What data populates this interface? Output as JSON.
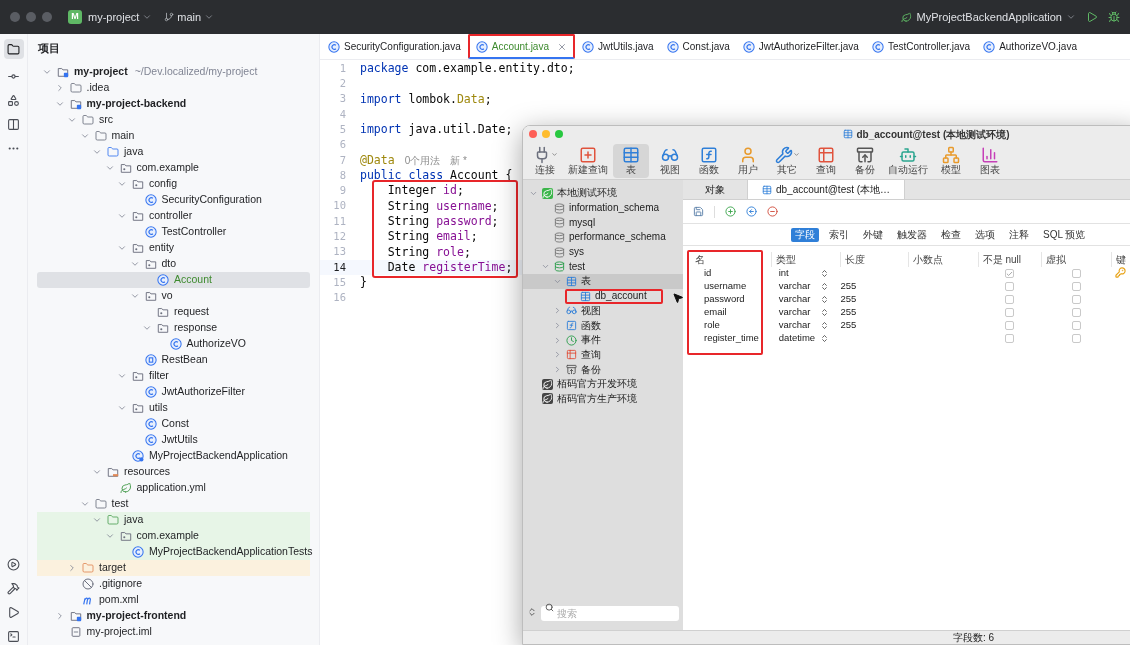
{
  "top_bar": {
    "project_badge": "M",
    "project": "my-project",
    "branch": "main",
    "run_configuration": "MyProjectBackendApplication"
  },
  "project_panel": {
    "title": "项目"
  },
  "project_tree": [
    {
      "name": "my-project",
      "kind": "module",
      "hint": "~/Dev.localized/my-project",
      "expanded": true,
      "selected": false,
      "children": [
        {
          "name": ".idea",
          "kind": "folder",
          "expanded": false,
          "selected": false
        },
        {
          "name": "my-project-backend",
          "kind": "module",
          "expanded": true,
          "selected": false,
          "children": [
            {
              "name": "src",
              "kind": "folder",
              "expanded": true,
              "selected": false,
              "children": [
                {
                  "name": "main",
                  "kind": "folder",
                  "expanded": true,
                  "selected": false,
                  "children": [
                    {
                      "name": "java",
                      "kind": "source-folder",
                      "expanded": true,
                      "selected": false,
                      "children": [
                        {
                          "name": "com.example",
                          "kind": "package",
                          "expanded": true,
                          "selected": false,
                          "children": [
                            {
                              "name": "config",
                              "kind": "package",
                              "expanded": true,
                              "selected": false,
                              "children": [
                                {
                                  "name": "SecurityConfiguration",
                                  "kind": "class",
                                  "selected": false
                                }
                              ]
                            },
                            {
                              "name": "controller",
                              "kind": "package",
                              "expanded": true,
                              "selected": false,
                              "children": [
                                {
                                  "name": "TestController",
                                  "kind": "class",
                                  "selected": false
                                }
                              ]
                            },
                            {
                              "name": "entity",
                              "kind": "package",
                              "expanded": true,
                              "selected": false,
                              "children": [
                                {
                                  "name": "dto",
                                  "kind": "package",
                                  "expanded": true,
                                  "selected": false,
                                  "children": [
                                    {
                                      "name": "Account",
                                      "kind": "class",
                                      "new_file": true,
                                      "selected": true
                                    }
                                  ]
                                },
                                {
                                  "name": "vo",
                                  "kind": "package",
                                  "expanded": true,
                                  "selected": false,
                                  "children": [
                                    {
                                      "name": "request",
                                      "kind": "package",
                                      "selected": false
                                    },
                                    {
                                      "name": "response",
                                      "kind": "package",
                                      "expanded": true,
                                      "selected": false,
                                      "children": [
                                        {
                                          "name": "AuthorizeVO",
                                          "kind": "class",
                                          "selected": false
                                        }
                                      ]
                                    }
                                  ]
                                },
                                {
                                  "name": "RestBean",
                                  "kind": "record",
                                  "selected": false
                                }
                              ]
                            },
                            {
                              "name": "filter",
                              "kind": "package",
                              "expanded": true,
                              "selected": false,
                              "children": [
                                {
                                  "name": "JwtAuthorizeFilter",
                                  "kind": "class",
                                  "selected": false
                                }
                              ]
                            },
                            {
                              "name": "utils",
                              "kind": "package",
                              "expanded": true,
                              "selected": false,
                              "children": [
                                {
                                  "name": "Const",
                                  "kind": "class",
                                  "selected": false
                                },
                                {
                                  "name": "JwtUtils",
                                  "kind": "class",
                                  "selected": false
                                }
                              ]
                            },
                            {
                              "name": "MyProjectBackendApplication",
                              "kind": "app-class",
                              "selected": false
                            }
                          ]
                        }
                      ]
                    },
                    {
                      "name": "resources",
                      "kind": "resources",
                      "expanded": true,
                      "selected": false,
                      "children": [
                        {
                          "name": "application.yml",
                          "kind": "yml",
                          "selected": false
                        }
                      ]
                    }
                  ]
                },
                {
                  "name": "test",
                  "kind": "folder",
                  "expanded": true,
                  "selected": false,
                  "children": [
                    {
                      "name": "java",
                      "kind": "test-folder",
                      "test_source": true,
                      "expanded": true,
                      "selected": false,
                      "children": [
                        {
                          "name": "com.example",
                          "kind": "package",
                          "test_source": true,
                          "expanded": true,
                          "selected": false,
                          "children": [
                            {
                              "name": "MyProjectBackendApplicationTests",
                              "kind": "class",
                              "test_source": true,
                              "selected": false
                            }
                          ]
                        }
                      ]
                    }
                  ]
                }
              ]
            },
            {
              "name": "target",
              "kind": "excluded-folder",
              "excluded": true,
              "expanded": false,
              "selected": false
            },
            {
              "name": ".gitignore",
              "kind": "gitignore",
              "selected": false
            },
            {
              "name": "pom.xml",
              "kind": "maven",
              "selected": false
            }
          ]
        },
        {
          "name": "my-project-frontend",
          "kind": "module",
          "expanded": false,
          "selected": false
        },
        {
          "name": "my-project.iml",
          "kind": "iml",
          "selected": false
        }
      ]
    }
  ],
  "editor_tabs": [
    {
      "label": "SecurityConfiguration.java",
      "selected": false,
      "new_file": false,
      "annotated": false
    },
    {
      "label": "Account.java",
      "selected": true,
      "new_file": true,
      "annotated": true
    },
    {
      "label": "JwtUtils.java",
      "selected": false,
      "new_file": false,
      "annotated": false
    },
    {
      "label": "Const.java",
      "selected": false,
      "new_file": false,
      "annotated": false
    },
    {
      "label": "JwtAuthorizeFilter.java",
      "selected": false,
      "new_file": false,
      "annotated": false
    },
    {
      "label": "TestController.java",
      "selected": false,
      "new_file": false,
      "annotated": false
    },
    {
      "label": "AuthorizeVO.java",
      "selected": false,
      "new_file": false,
      "annotated": false
    }
  ],
  "code_lines": [
    {
      "number": "1",
      "current": false,
      "boxed": false,
      "tokens": [
        {
          "kind": "keyword",
          "text": "package"
        },
        {
          "kind": "plain",
          "text": " com.example.entity.dto;"
        }
      ]
    },
    {
      "number": "2",
      "current": false,
      "boxed": false
    },
    {
      "number": "3",
      "current": false,
      "boxed": false,
      "tokens": [
        {
          "kind": "keyword",
          "text": "import"
        },
        {
          "kind": "plain",
          "text": " lombok."
        },
        {
          "kind": "annotation",
          "text": "Data"
        },
        {
          "kind": "plain",
          "text": ";"
        }
      ]
    },
    {
      "number": "4",
      "current": false,
      "boxed": false
    },
    {
      "number": "5",
      "current": false,
      "boxed": false,
      "tokens": [
        {
          "kind": "keyword",
          "text": "import"
        },
        {
          "kind": "plain",
          "text": " java.util.Date;"
        }
      ]
    },
    {
      "number": "6",
      "current": false,
      "boxed": false
    },
    {
      "number": "7",
      "current": false,
      "boxed": false,
      "tokens": [
        {
          "kind": "annotation",
          "text": "@Data"
        },
        {
          "kind": "hint",
          "text": "0个用法"
        },
        {
          "kind": "hint",
          "text": "新 *"
        }
      ]
    },
    {
      "number": "8",
      "current": false,
      "boxed": false,
      "tokens": [
        {
          "kind": "keyword",
          "text": "public class"
        },
        {
          "kind": "plain",
          "text": " Account {"
        }
      ]
    },
    {
      "number": "9",
      "current": false,
      "boxed": true,
      "tokens": [
        {
          "kind": "plain",
          "text": "    Integer "
        },
        {
          "kind": "field",
          "text": "id"
        },
        {
          "kind": "plain",
          "text": ";"
        }
      ]
    },
    {
      "number": "10",
      "current": false,
      "boxed": true,
      "tokens": [
        {
          "kind": "plain",
          "text": "    String "
        },
        {
          "kind": "field",
          "text": "username"
        },
        {
          "kind": "plain",
          "text": ";"
        }
      ]
    },
    {
      "number": "11",
      "current": false,
      "boxed": true,
      "tokens": [
        {
          "kind": "plain",
          "text": "    String "
        },
        {
          "kind": "field",
          "text": "password"
        },
        {
          "kind": "plain",
          "text": ";"
        }
      ]
    },
    {
      "number": "12",
      "current": false,
      "boxed": true,
      "tokens": [
        {
          "kind": "plain",
          "text": "    String "
        },
        {
          "kind": "field",
          "text": "email"
        },
        {
          "kind": "plain",
          "text": ";"
        }
      ]
    },
    {
      "number": "13",
      "current": false,
      "boxed": true,
      "tokens": [
        {
          "kind": "plain",
          "text": "    String "
        },
        {
          "kind": "field",
          "text": "role"
        },
        {
          "kind": "plain",
          "text": ";"
        }
      ]
    },
    {
      "number": "14",
      "current": true,
      "boxed": true,
      "tokens": [
        {
          "kind": "plain",
          "text": "    Date "
        },
        {
          "kind": "field",
          "text": "registerTime"
        },
        {
          "kind": "plain",
          "text": ";"
        }
      ]
    },
    {
      "number": "15",
      "current": false,
      "boxed": false,
      "tokens": [
        {
          "kind": "plain",
          "text": "}"
        }
      ]
    },
    {
      "number": "16",
      "current": false,
      "boxed": false
    }
  ],
  "db_window": {
    "title": "db_account@test (本地测试环境)",
    "toolbar": [
      {
        "label": "连接",
        "kind": "connect",
        "has_menu": true,
        "selected": false
      },
      {
        "label": "新建查询",
        "kind": "new-query",
        "has_menu": false,
        "selected": false
      },
      {
        "label": "表",
        "kind": "table",
        "has_menu": false,
        "selected": true
      },
      {
        "label": "视图",
        "kind": "view",
        "has_menu": false,
        "selected": false
      },
      {
        "label": "函数",
        "kind": "function",
        "has_menu": false,
        "selected": false
      },
      {
        "label": "用户",
        "kind": "user",
        "has_menu": false,
        "selected": false
      },
      {
        "label": "其它",
        "kind": "other",
        "has_menu": true,
        "selected": false
      },
      {
        "label": "查询",
        "kind": "query",
        "has_menu": false,
        "selected": false
      },
      {
        "label": "备份",
        "kind": "backup",
        "has_menu": false,
        "selected": false
      },
      {
        "label": "自动运行",
        "kind": "automation",
        "has_menu": false,
        "selected": false
      },
      {
        "label": "模型",
        "kind": "model",
        "has_menu": false,
        "selected": false
      },
      {
        "label": "图表",
        "kind": "chart",
        "has_menu": false,
        "selected": false
      }
    ],
    "tree": [
      {
        "name": "本地测试环境",
        "kind": "connection-active",
        "expanded": true,
        "selected": false,
        "children": [
          {
            "name": "information_schema",
            "kind": "database",
            "selected": false
          },
          {
            "name": "mysql",
            "kind": "database",
            "selected": false
          },
          {
            "name": "performance_schema",
            "kind": "database",
            "selected": false
          },
          {
            "name": "sys",
            "kind": "database",
            "selected": false
          },
          {
            "name": "test",
            "kind": "database-open",
            "expanded": true,
            "selected": false,
            "children": [
              {
                "name": "表",
                "kind": "tables",
                "expanded": true,
                "selected": true,
                "children": [
                  {
                    "name": "db_account",
                    "kind": "table",
                    "selected": false,
                    "annotated": true
                  }
                ]
              },
              {
                "name": "视图",
                "kind": "views",
                "expanded": false,
                "selected": false
              },
              {
                "name": "函数",
                "kind": "functions",
                "expanded": false,
                "selected": false
              },
              {
                "name": "事件",
                "kind": "events",
                "expanded": false,
                "selected": false
              },
              {
                "name": "查询",
                "kind": "queries",
                "expanded": false,
                "selected": false
              },
              {
                "name": "备份",
                "kind": "backups",
                "expanded": false,
                "selected": false
              }
            ]
          }
        ]
      },
      {
        "name": "栢码官方开发环境",
        "kind": "connection",
        "selected": false
      },
      {
        "name": "栢码官方生产环境",
        "kind": "connection",
        "selected": false
      }
    ],
    "tabs": [
      {
        "label": "对象",
        "selected": false
      },
      {
        "label": "db_account@test (本地…",
        "selected": true
      }
    ],
    "subtabs": [
      {
        "label": "字段",
        "selected": true
      },
      {
        "label": "索引",
        "selected": false
      },
      {
        "label": "外键",
        "selected": false
      },
      {
        "label": "触发器",
        "selected": false
      },
      {
        "label": "检查",
        "selected": false
      },
      {
        "label": "选项",
        "selected": false
      },
      {
        "label": "注释",
        "selected": false
      },
      {
        "label": "SQL 预览",
        "selected": false
      }
    ],
    "table": {
      "columns": [
        "名",
        "类型",
        "长度",
        "小数点",
        "不是 null",
        "虚拟",
        "键"
      ],
      "name_column_boxed": true,
      "rows": [
        {
          "name": "id",
          "type": "int",
          "not_null": true,
          "virtual": false,
          "primary_key": true
        },
        {
          "name": "username",
          "type": "varchar",
          "length": "255",
          "not_null": false,
          "virtual": false,
          "primary_key": false
        },
        {
          "name": "password",
          "type": "varchar",
          "length": "255",
          "not_null": false,
          "virtual": false,
          "primary_key": false
        },
        {
          "name": "email",
          "type": "varchar",
          "length": "255",
          "not_null": false,
          "virtual": false,
          "primary_key": false
        },
        {
          "name": "role",
          "type": "varchar",
          "length": "255",
          "not_null": false,
          "virtual": false,
          "primary_key": false
        },
        {
          "name": "register_time",
          "type": "datetime",
          "not_null": false,
          "virtual": false,
          "primary_key": false
        }
      ]
    },
    "search": {
      "placeholder": "搜索"
    },
    "status": "字段数: 6"
  }
}
